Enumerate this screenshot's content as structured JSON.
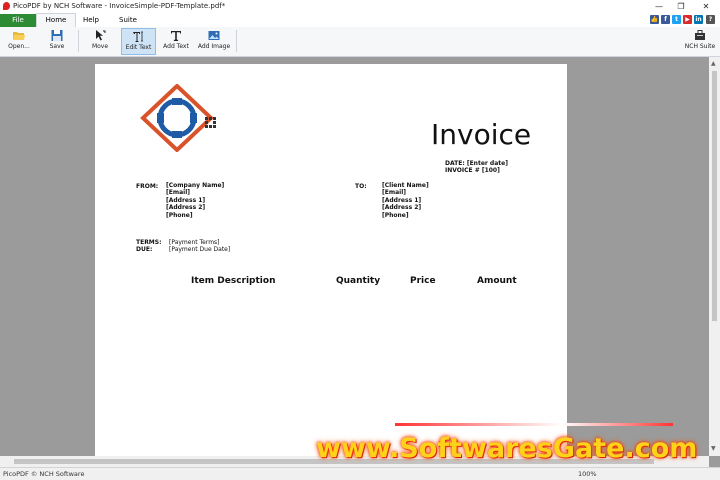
{
  "window": {
    "title": "PicoPDF by NCH Software - InvoiceSimple-PDF-Template.pdf*",
    "minimize": "—",
    "maximize": "❐",
    "close": "✕"
  },
  "tabs": [
    "File",
    "Home",
    "Help",
    "Suite"
  ],
  "social": [
    "thumbs-up-icon",
    "facebook-icon",
    "twitter-icon",
    "youtube-icon",
    "linkedin-icon",
    "help-icon"
  ],
  "ribbon": {
    "open": "Open...",
    "save": "Save",
    "move": "Move",
    "edit_text": "Edit Text",
    "add_text": "Add Text",
    "add_image": "Add Image",
    "nch_suite": "NCH Suite"
  },
  "invoice": {
    "title": "Invoice",
    "date_line": "DATE: [Enter date]",
    "number_line": "INVOICE # [100]",
    "from_label": "FROM:",
    "from_lines": [
      "[Company Name]",
      "[Email]",
      "[Address 1]",
      "[Address 2]",
      "[Phone]"
    ],
    "to_label": "TO:",
    "to_lines": [
      "[Client Name]",
      "[Email]",
      "[Address 1]",
      "[Address 2]",
      "[Phone]"
    ],
    "terms_label": "TERMS:",
    "due_label": "DUE:",
    "terms_value": "[Payment Terms]",
    "due_value": "[Payment Due Date]",
    "columns": [
      "Item Description",
      "Quantity",
      "Price",
      "Amount"
    ]
  },
  "status": {
    "copyright": "PicoPDF © NCH Software",
    "zoom": "100%"
  },
  "watermark": "www.SoftwaresGate.com",
  "colors": {
    "file_tab": "#2d8a35",
    "logo_orange": "#d9532a",
    "logo_blue": "#1f5aa6",
    "active_button": "#cfe3f7"
  }
}
